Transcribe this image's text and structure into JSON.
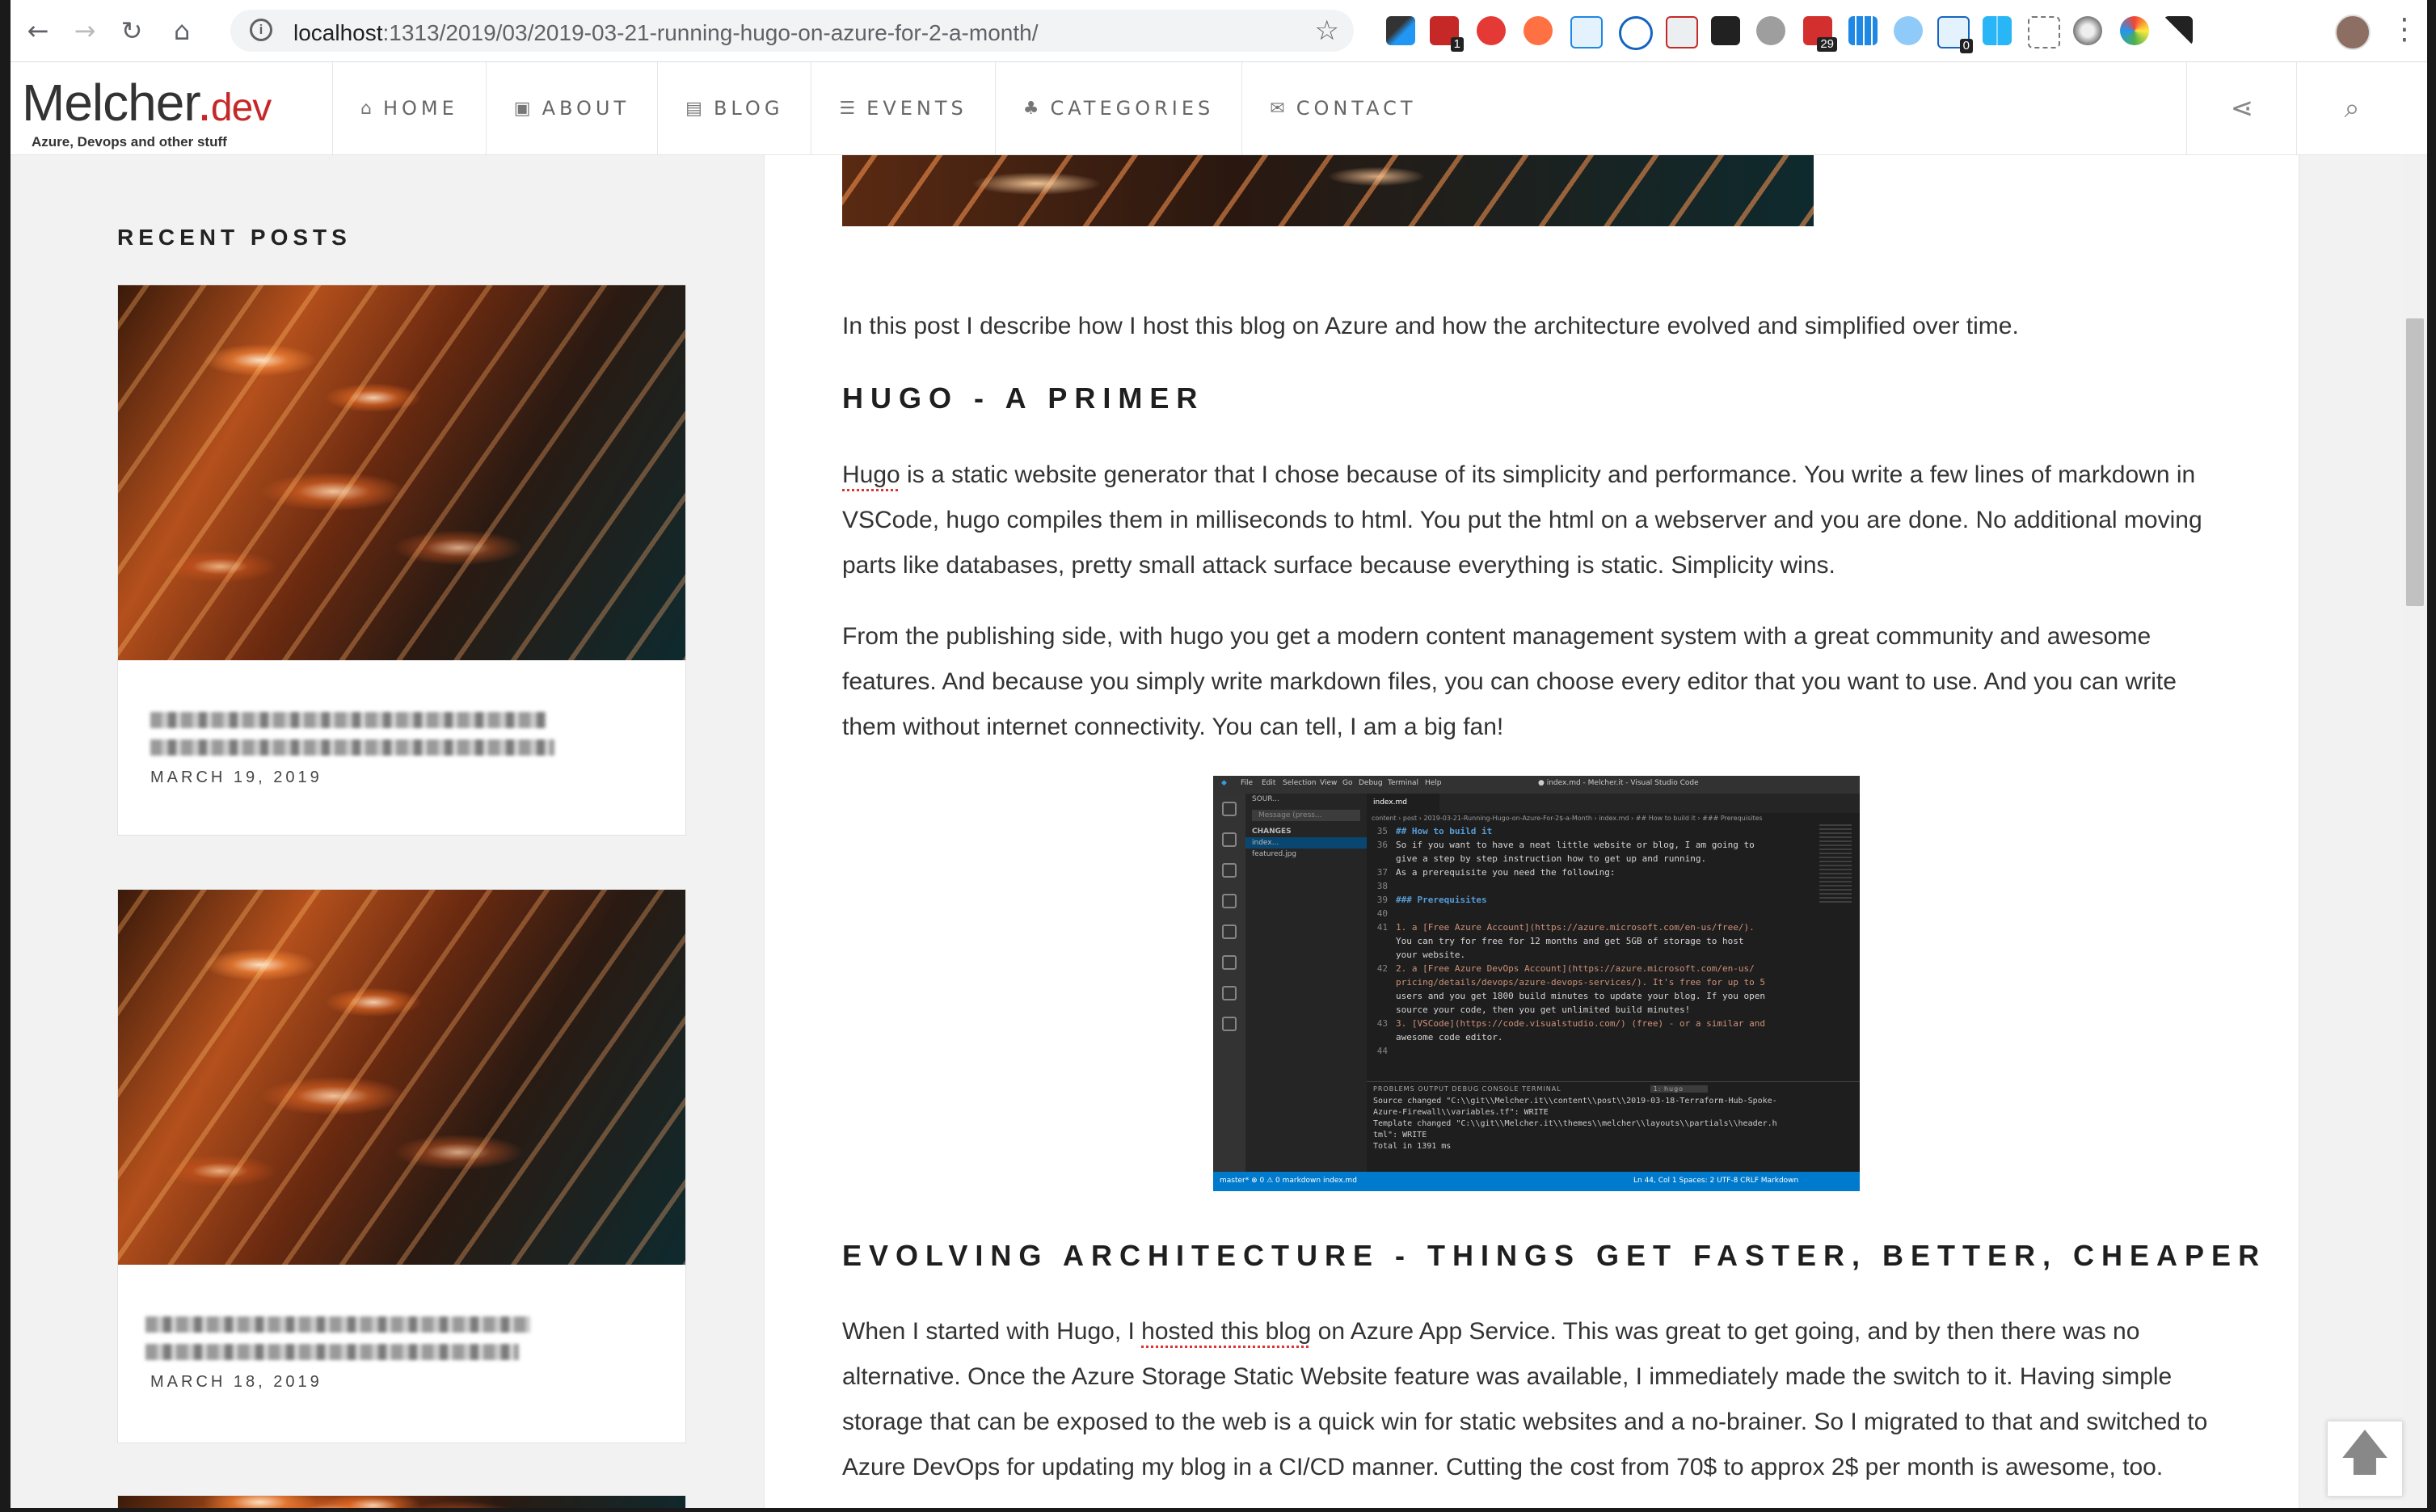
{
  "browser": {
    "url_host": "localhost",
    "url_path": ":1313/2019/03/2019-03-21-running-hugo-on-azure-for-2-a-month/",
    "extension_badges": [
      "1",
      "29",
      "0"
    ]
  },
  "site": {
    "logo_main": "Melcher",
    "logo_dot": ".",
    "logo_tld": "dev",
    "tagline": "Azure, Devops and other stuff",
    "nav": [
      {
        "label": "HOME",
        "icon": "home-icon"
      },
      {
        "label": "ABOUT",
        "icon": "id-card-icon"
      },
      {
        "label": "BLOG",
        "icon": "newspaper-icon"
      },
      {
        "label": "EVENTS",
        "icon": "list-icon"
      },
      {
        "label": "CATEGORIES",
        "icon": "sitemap-icon"
      },
      {
        "label": "CONTACT",
        "icon": "envelope-icon"
      }
    ]
  },
  "sidebar": {
    "title": "RECENT POSTS",
    "posts": [
      {
        "date": "MARCH 19, 2019"
      },
      {
        "date": "MARCH 18, 2019"
      }
    ]
  },
  "article": {
    "intro": "In this post I describe how I host this blog on Azure and how the architecture evolved and simplified over time.",
    "h_primer": "HUGO - A PRIMER",
    "p1_link": "Hugo",
    "p1_rest": " is a static website generator that I chose because of its simplicity and performance. You write a few lines of markdown in VSCode, hugo compiles them in milliseconds to html. You put the html on a webserver and you are done. No additional moving parts like databases, pretty small attack surface because everything is static. Simplicity wins.",
    "p2": "From the publishing side, with hugo you get a modern content management system with a great community and awesome features. And because you simply write markdown files, you can choose every editor that you want to use. And you can write them without internet connectivity. You can tell, I am a big fan!",
    "h_arch": "EVOLVING ARCHITECTURE - THINGS GET FASTER, BETTER, CHEAPER",
    "p3_a": "When I started with Hugo, I ",
    "p3_link": "hosted this blog",
    "p3_b": " on Azure App Service. This was great to get going, and by then there was no alternative. Once the Azure Storage Static Website feature was available, I immediately made the switch to it. Having simple storage that can be exposed to the web is a quick win for static websites and a no-brainer. So I migrated to that and switched to Azure DevOps for updating my blog in a CI/CD manner. Cutting the cost from 70$ to approx 2$ per month is awesome, too."
  },
  "vscode": {
    "title": "● index.md - Melcher.it - Visual Studio Code",
    "menu": [
      "File",
      "Edit",
      "Selection",
      "View",
      "Go",
      "Debug",
      "Terminal",
      "Help"
    ],
    "tab": "index.md",
    "breadcrumb": "content › post › 2019-03-21-Running-Hugo-on-Azure-For-2$-a-Month › index.md › ## How to build it › ### Prerequisites",
    "side_header": "SOUR...",
    "side_input": "Message (press...",
    "side_changes": "CHANGES",
    "side_files": [
      "index...",
      "featured.jpg"
    ],
    "lines": [
      {
        "n": "35",
        "text": "## How to build it",
        "cls": "h"
      },
      {
        "n": "36",
        "text": "So if you want to have a neat little website or blog, I am going to",
        "cls": ""
      },
      {
        "n": "",
        "text": "give a step by step instruction how to get up and running.",
        "cls": ""
      },
      {
        "n": "37",
        "text": "As a prerequisite you need the following:",
        "cls": ""
      },
      {
        "n": "38",
        "text": "",
        "cls": ""
      },
      {
        "n": "39",
        "text": "### Prerequisites",
        "cls": "h"
      },
      {
        "n": "40",
        "text": "",
        "cls": ""
      },
      {
        "n": "41",
        "text": "1. a [Free Azure Account](https://azure.microsoft.com/en-us/free/).",
        "cls": "s"
      },
      {
        "n": "",
        "text": "You can try for free for 12 months and get 5GB of storage to host",
        "cls": ""
      },
      {
        "n": "",
        "text": "your website.",
        "cls": ""
      },
      {
        "n": "42",
        "text": "2. a [Free Azure DevOps Account](https://azure.microsoft.com/en-us/",
        "cls": "s"
      },
      {
        "n": "",
        "text": "pricing/details/devops/azure-devops-services/). It's free for up to 5",
        "cls": "s"
      },
      {
        "n": "",
        "text": "users and you get 1800 build minutes to update your blog. If you open",
        "cls": ""
      },
      {
        "n": "",
        "text": "source your code, then you get unlimited build minutes!",
        "cls": ""
      },
      {
        "n": "43",
        "text": "3. [VSCode](https://code.visualstudio.com/) (free) - or a similar and",
        "cls": "s"
      },
      {
        "n": "",
        "text": "awesome code editor.",
        "cls": ""
      },
      {
        "n": "44",
        "text": "",
        "cls": ""
      }
    ],
    "terminal_tabs": "PROBLEMS  OUTPUT  DEBUG CONSOLE  TERMINAL",
    "terminal_select": "1: hugo",
    "terminal": "Source changed \"C:\\\\git\\\\Melcher.it\\\\content\\\\post\\\\2019-03-18-Terraform-Hub-Spoke-\nAzure-Firewall\\\\variables.tf\": WRITE\nTemplate changed \"C:\\\\git\\\\Melcher.it\\\\themes\\\\melcher\\\\layouts\\\\partials\\\\header.h\ntml\": WRITE\nTotal in 1391 ms",
    "status_left": "master*   ⊗ 0 ⚠ 0   markdown   index.md",
    "status_right": "Ln 44, Col 1   Spaces: 2   UTF-8   CRLF   Markdown"
  },
  "colors": {
    "accent": "#c62828",
    "vscode_status": "#007acc"
  }
}
